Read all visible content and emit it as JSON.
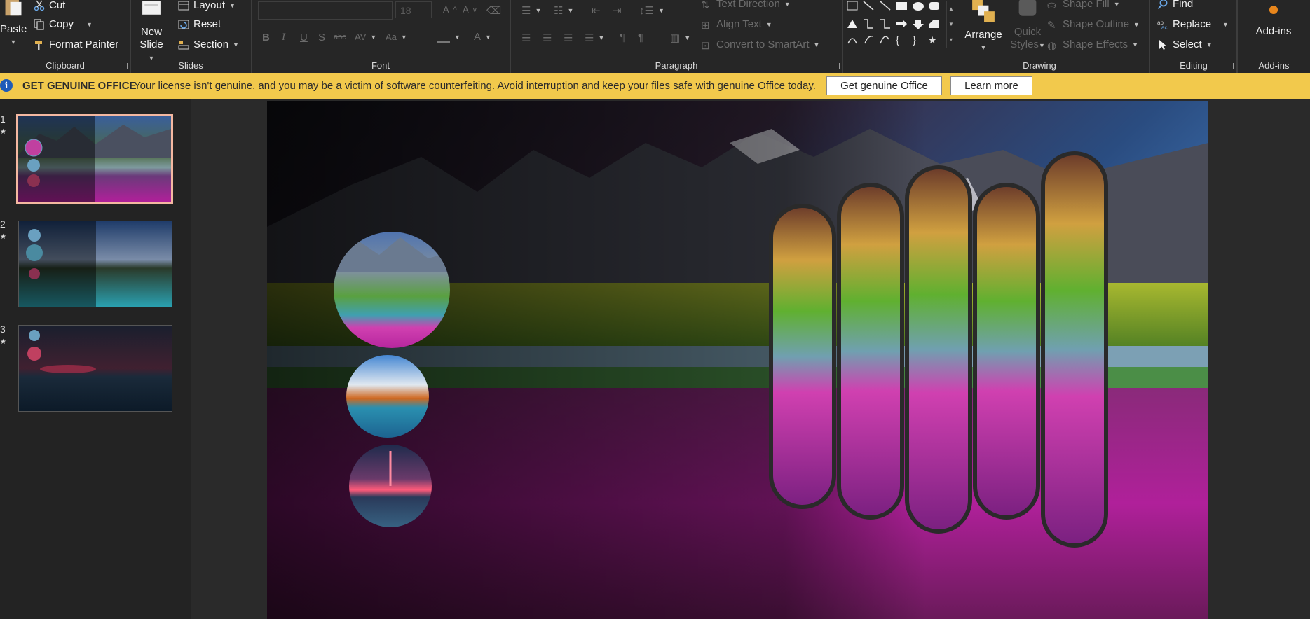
{
  "ribbon": {
    "clipboard": {
      "paste": "Paste",
      "cut": "Cut",
      "copy": "Copy",
      "format_painter": "Format Painter",
      "label": "Clipboard"
    },
    "slides": {
      "new_slide_line1": "New",
      "new_slide_line2": "Slide",
      "layout": "Layout",
      "reset": "Reset",
      "section": "Section",
      "label": "Slides"
    },
    "font": {
      "font_size": "18",
      "label": "Font"
    },
    "paragraph": {
      "text_direction": "Text Direction",
      "align_text": "Align Text",
      "convert_smartart": "Convert to SmartArt",
      "label": "Paragraph"
    },
    "drawing": {
      "arrange": "Arrange",
      "quick_styles_line1": "Quick",
      "quick_styles_line2": "Styles",
      "shape_fill": "Shape Fill",
      "shape_outline": "Shape Outline",
      "shape_effects": "Shape Effects",
      "label": "Drawing"
    },
    "editing": {
      "find": "Find",
      "replace": "Replace",
      "select": "Select",
      "label": "Editing"
    },
    "addins": {
      "button": "Add-ins",
      "label": "Add-ins"
    }
  },
  "notification": {
    "title": "GET GENUINE OFFICE",
    "message": "Your license isn't genuine, and you may be a victim of software counterfeiting. Avoid interruption and keep your files safe with genuine Office today.",
    "primary_button": "Get genuine Office",
    "secondary_button": "Learn more",
    "color": "#f2c94c"
  },
  "thumbnails": [
    {
      "number": "1",
      "star": "★",
      "active": true
    },
    {
      "number": "2",
      "star": "★",
      "active": false
    },
    {
      "number": "3",
      "star": "★",
      "active": false
    }
  ],
  "colors": {
    "ribbon_bg": "#262626",
    "thumb_active_border": "#f4b8a1",
    "accent": "#f2c94c"
  }
}
